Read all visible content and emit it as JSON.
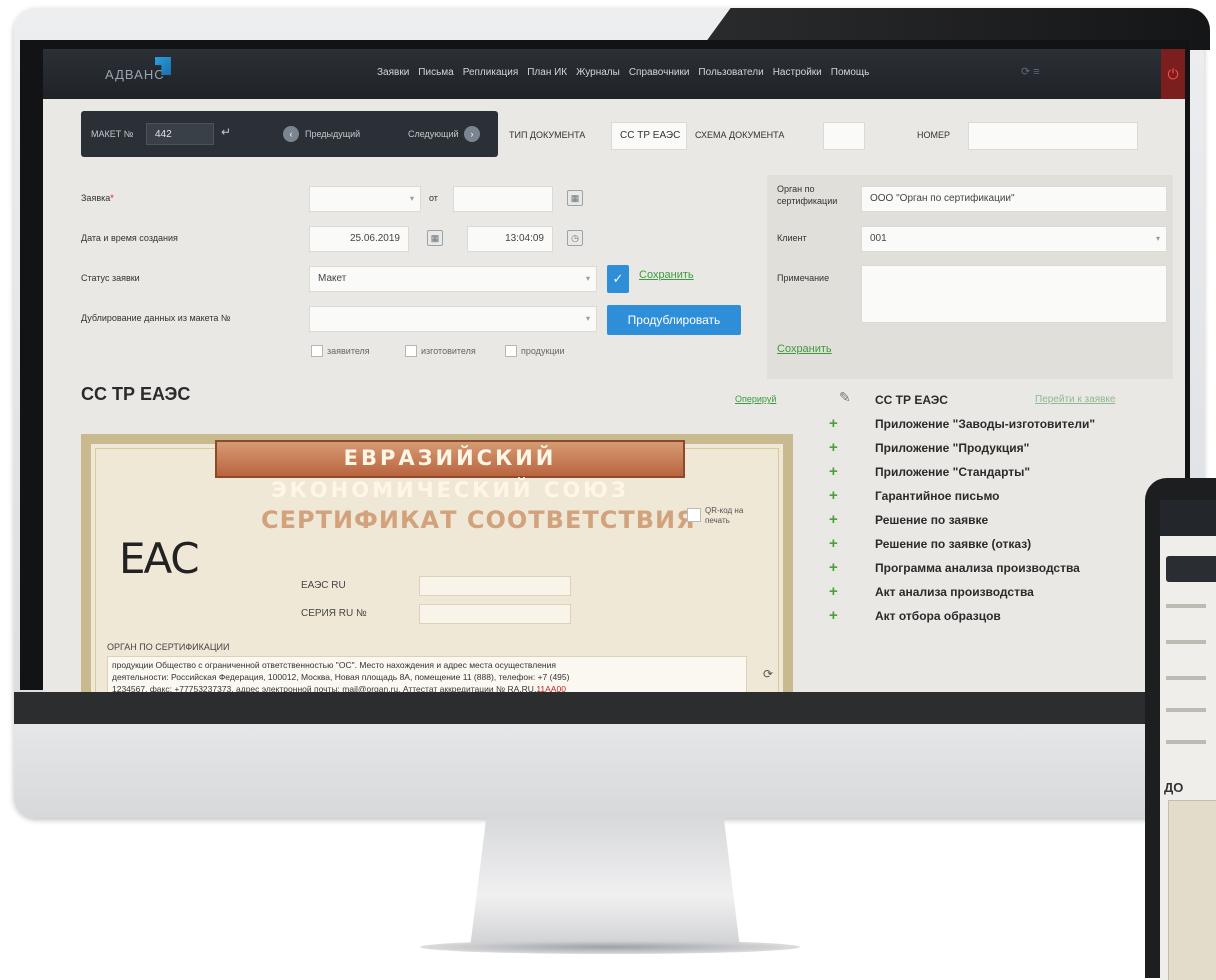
{
  "nav": {
    "logo": "АДВАНС",
    "menu": [
      "Заявки",
      "Письма",
      "Репликация",
      "План ИК",
      "Журналы",
      "Справочники",
      "Пользователи",
      "Настройки",
      "Помощь"
    ],
    "extra": "⟳ ≡"
  },
  "bar": {
    "maket_label": "МАКЕТ №",
    "maket_value": "442",
    "prev": "Предыдущий",
    "next": "Следующий",
    "doc_type_label": "ТИП ДОКУМЕНТА",
    "doc_type_value": "СС ТР ЕАЭС",
    "schema_label": "СХЕМА ДОКУМЕНТА",
    "number_label": "НОМЕР"
  },
  "form": {
    "zayavka_label": "Заявка",
    "ot_label": "от",
    "date_label": "Дата и время создания",
    "date_value": "25.06.2019",
    "time_value": "13:04:09",
    "status_label": "Статус заявки",
    "status_value": "Макет",
    "save_label": "Сохранить",
    "dup_label": "Дублирование данных из макета №",
    "dup_button": "Продублировать",
    "checks": [
      "заявителя",
      "изготовителя",
      "продукции"
    ]
  },
  "right": {
    "organ_label": "Орган по сертификации",
    "organ_value": "ООО \"Орган по сертификации\"",
    "client_label": "Клиент",
    "client_value": "001",
    "note_label": "Примечание",
    "save_link": "Сохранить"
  },
  "main": {
    "title": "СС ТР ЕАЭС",
    "sign_link": "Оперируй",
    "cert": {
      "band": "ЕВРАЗИЙСКИЙ ЭКОНОМИЧЕСКИЙ СОЮЗ",
      "title": "СЕРТИФИКАТ СООТВЕТСТВИЯ",
      "eac": "ЕАС",
      "qr": "QR-код на печать",
      "eaes_label": "ЕАЭС RU",
      "series_label": "СЕРИЯ RU №",
      "organ_heading": "ОРГАН ПО СЕРТИФИКАЦИИ",
      "text_1": "продукции Общество с ограниченной ответственностью \"ОС\". Место нахождения и адрес места осуществления",
      "text_2": "деятельности: Российская Федерация, 100012, Москва, Новая площадь 8А, помещение 11 (888), телефон: +7 (495)",
      "text_3": "1234567, факс: +77753237373, адрес электронной почты: mail@organ.ru. Аттестат аккредитации № RA.RU.",
      "text_link": "11АА00"
    }
  },
  "doclist": {
    "head": "СС ТР ЕАЭС",
    "head_link": "Перейти к заявке",
    "items": [
      "Приложение \"Заводы-изготовители\"",
      "Приложение \"Продукция\"",
      "Приложение \"Стандарты\"",
      "Гарантийное письмо",
      "Решение по заявке",
      "Решение по заявке (отказ)",
      "Программа анализа производства",
      "Акт анализа производства",
      "Акт отбора образцов"
    ]
  },
  "tablet": {
    "heading": "ДО"
  }
}
